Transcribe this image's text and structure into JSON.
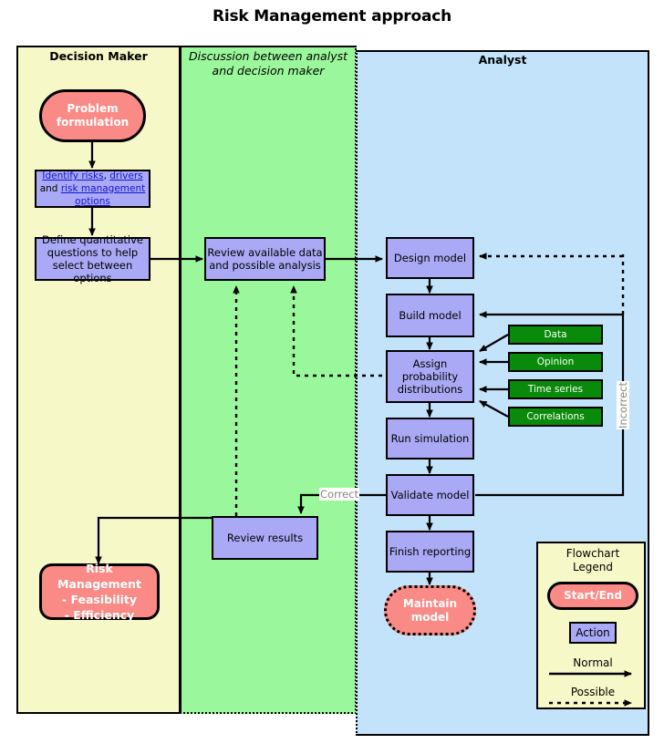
{
  "title": "Risk Management approach",
  "lanes": {
    "decision_maker": "Decision Maker",
    "discussion": "Discussion between analyst and decision maker",
    "analyst": "Analyst"
  },
  "nodes": {
    "problem_formulation": "Problem formulation",
    "identify": {
      "link1": "Identify risks",
      "sep1": ", ",
      "link2": "drivers",
      "plain": " and ",
      "link3": "risk management options"
    },
    "define_questions": "Define quantitative questions to help select between options",
    "review_data": "Review available data and possible analysis",
    "design_model": "Design model",
    "build_model": "Build model",
    "assign_prob": "Assign probability distributions",
    "run_simulation": "Run simulation",
    "validate_model": "Validate model",
    "finish_reporting": "Finish reporting",
    "maintain_model": "Maintain model",
    "review_results": "Review results",
    "risk_management": "Risk Management - Feasibility - Efficiency",
    "risk_management_lines": [
      "Risk Management",
      "- Feasibility",
      "- Efficiency"
    ]
  },
  "data_sources": [
    {
      "label": "Data"
    },
    {
      "label": "Opinion"
    },
    {
      "label": "Time series"
    },
    {
      "label": "Correlations"
    }
  ],
  "edge_labels": {
    "correct": "Correct",
    "incorrect": "Incorrect"
  },
  "legend": {
    "title_line1": "Flowchart",
    "title_line2": "Legend",
    "start_end": "Start/End",
    "action": "Action",
    "normal": "Normal",
    "possible": "Possible"
  },
  "colors": {
    "lane_decision_maker": "#f7f8c8",
    "lane_discussion": "#9bf79b",
    "lane_analyst": "#c3e3fb",
    "terminal": "#f98a86",
    "action": "#a9a9f5",
    "data_source": "#0a8a0a",
    "link": "#1414d6",
    "edge_label": "#888888"
  }
}
